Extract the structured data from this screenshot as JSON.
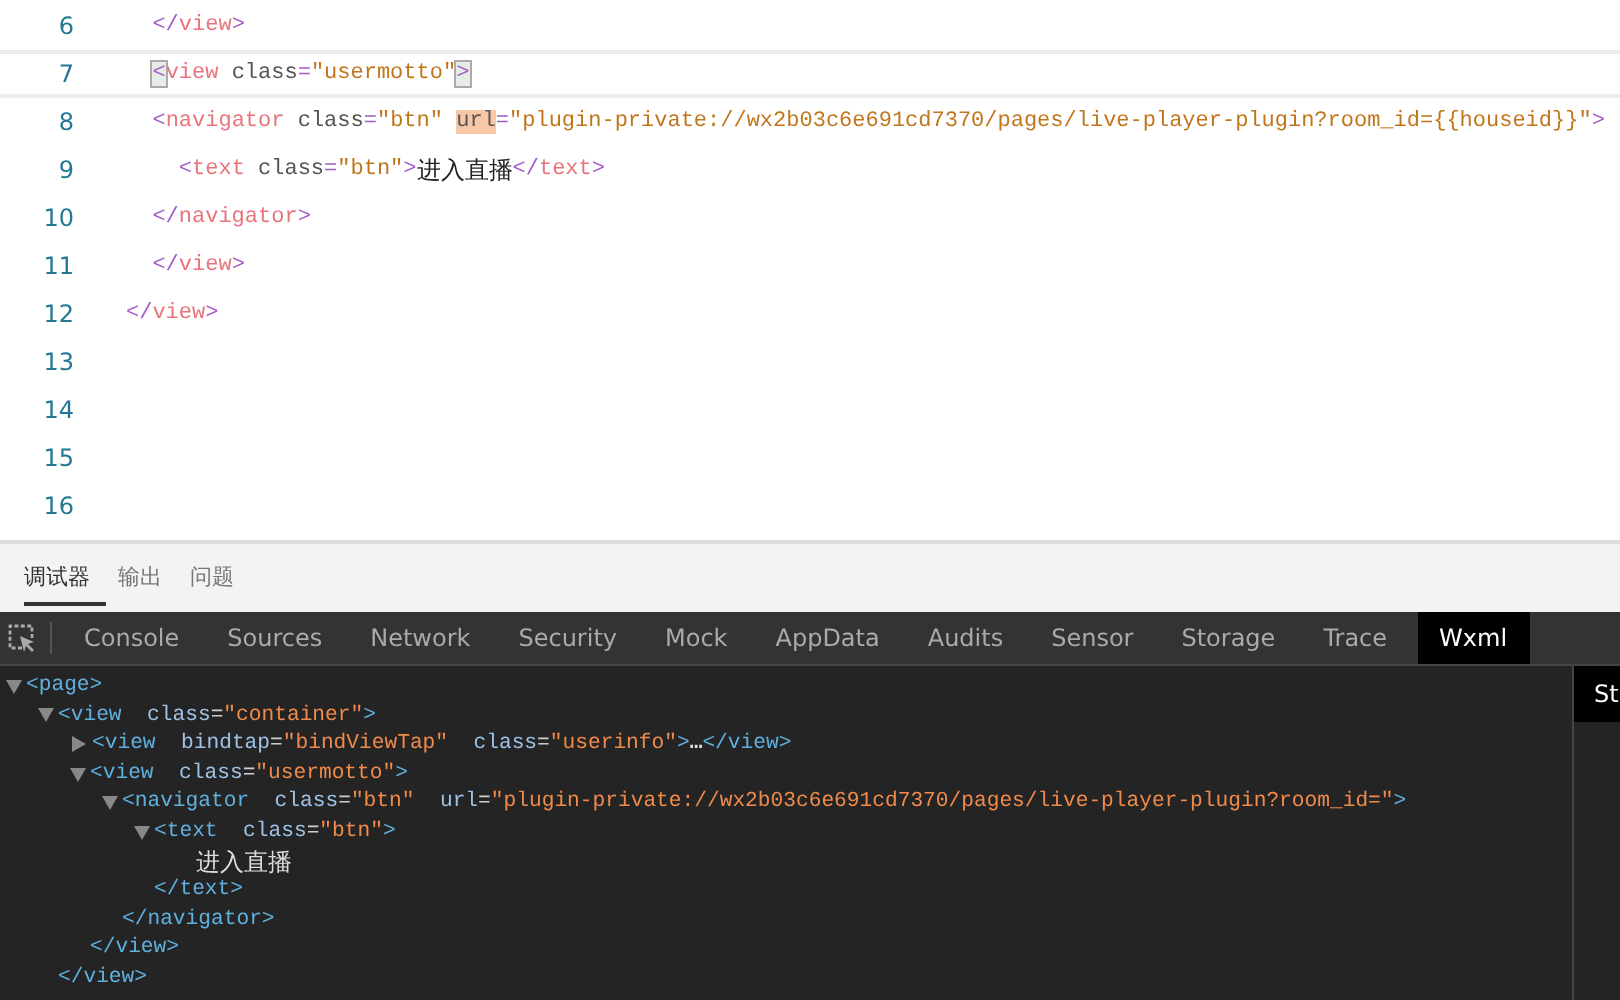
{
  "editor": {
    "lines": [
      {
        "number": "6",
        "current": false,
        "tokens": [
          {
            "kind": "punct",
            "text": "  </"
          },
          {
            "kind": "tag",
            "text": "view"
          },
          {
            "kind": "punct",
            "text": ">"
          }
        ]
      },
      {
        "number": "7",
        "current": true,
        "tokens": [
          {
            "kind": "punct",
            "text": "  <",
            "matched": true
          },
          {
            "kind": "tag",
            "text": "view"
          },
          {
            "kind": "attr",
            "text": " class"
          },
          {
            "kind": "punct",
            "text": "="
          },
          {
            "kind": "string",
            "text": "\"usermotto\""
          },
          {
            "kind": "punct",
            "text": ">",
            "matched": true
          }
        ]
      },
      {
        "number": "8",
        "current": false,
        "tokens": [
          {
            "kind": "punct",
            "text": "  <"
          },
          {
            "kind": "tag",
            "text": "navigator"
          },
          {
            "kind": "attr",
            "text": " class"
          },
          {
            "kind": "punct",
            "text": "="
          },
          {
            "kind": "string",
            "text": "\"btn\""
          },
          {
            "kind": "attr",
            "text": " url",
            "selected": true
          },
          {
            "kind": "punct",
            "text": "="
          },
          {
            "kind": "string",
            "text": "\"plugin-private://wx2b03c6e691cd7370/pages/live-player-plugin?room_id={{houseid}}\""
          },
          {
            "kind": "punct",
            "text": ">"
          }
        ]
      },
      {
        "number": "9",
        "current": false,
        "tokens": [
          {
            "kind": "punct",
            "text": "    <"
          },
          {
            "kind": "tag",
            "text": "text"
          },
          {
            "kind": "attr",
            "text": " class"
          },
          {
            "kind": "punct",
            "text": "="
          },
          {
            "kind": "string",
            "text": "\"btn\""
          },
          {
            "kind": "punct",
            "text": ">"
          },
          {
            "kind": "content",
            "text": "进入直播"
          },
          {
            "kind": "punct",
            "text": "</"
          },
          {
            "kind": "tag",
            "text": "text"
          },
          {
            "kind": "punct",
            "text": ">"
          }
        ]
      },
      {
        "number": "10",
        "current": false,
        "tokens": [
          {
            "kind": "punct",
            "text": "  </"
          },
          {
            "kind": "tag",
            "text": "navigator"
          },
          {
            "kind": "punct",
            "text": ">"
          }
        ]
      },
      {
        "number": "11",
        "current": false,
        "tokens": [
          {
            "kind": "punct",
            "text": "  </"
          },
          {
            "kind": "tag",
            "text": "view"
          },
          {
            "kind": "punct",
            "text": ">"
          }
        ]
      },
      {
        "number": "12",
        "current": false,
        "tokens": [
          {
            "kind": "punct",
            "text": "</"
          },
          {
            "kind": "tag",
            "text": "view"
          },
          {
            "kind": "punct",
            "text": ">"
          }
        ]
      },
      {
        "number": "13",
        "current": false
      },
      {
        "number": "14",
        "current": false
      },
      {
        "number": "15",
        "current": false
      },
      {
        "number": "16",
        "current": false
      }
    ]
  },
  "panel_tabs": [
    {
      "label": "调试器",
      "selected": true
    },
    {
      "label": "输出",
      "selected": false
    },
    {
      "label": "问题",
      "selected": false
    }
  ],
  "devtools_tabs": [
    {
      "label": "Console",
      "selected": false
    },
    {
      "label": "Sources",
      "selected": false
    },
    {
      "label": "Network",
      "selected": false
    },
    {
      "label": "Security",
      "selected": false
    },
    {
      "label": "Mock",
      "selected": false
    },
    {
      "label": "AppData",
      "selected": false
    },
    {
      "label": "Audits",
      "selected": false
    },
    {
      "label": "Sensor",
      "selected": false
    },
    {
      "label": "Storage",
      "selected": false
    },
    {
      "label": "Trace",
      "selected": false
    },
    {
      "label": "Wxml",
      "selected": true
    }
  ],
  "wxml_tree": [
    {
      "kind": "element",
      "expanded": true,
      "open": [
        {
          "kind": "tag",
          "text": "<page>"
        }
      ],
      "children": [
        {
          "kind": "element",
          "expanded": true,
          "open": [
            {
              "kind": "tag",
              "text": "<view"
            },
            {
              "kind": "attr",
              "text": "  class"
            },
            {
              "kind": "punct",
              "text": "="
            },
            {
              "kind": "string",
              "text": "\"container\""
            },
            {
              "kind": "tag",
              "text": ">"
            }
          ],
          "close": "</view>",
          "children": [
            {
              "kind": "element",
              "expanded": false,
              "open": [
                {
                  "kind": "tag",
                  "text": "<view"
                },
                {
                  "kind": "attr",
                  "text": "  bindtap"
                },
                {
                  "kind": "punct",
                  "text": "="
                },
                {
                  "kind": "string",
                  "text": "\"bindViewTap\""
                },
                {
                  "kind": "attr",
                  "text": "  class"
                },
                {
                  "kind": "punct",
                  "text": "="
                },
                {
                  "kind": "string",
                  "text": "\"userinfo\""
                },
                {
                  "kind": "tag",
                  "text": ">"
                }
              ],
              "ellipsis": "…",
              "close": "</view>"
            },
            {
              "kind": "element",
              "expanded": true,
              "open": [
                {
                  "kind": "tag",
                  "text": "<view"
                },
                {
                  "kind": "attr",
                  "text": "  class"
                },
                {
                  "kind": "punct",
                  "text": "="
                },
                {
                  "kind": "string",
                  "text": "\"usermotto\""
                },
                {
                  "kind": "tag",
                  "text": ">"
                }
              ],
              "close": "</view>",
              "children": [
                {
                  "kind": "element",
                  "expanded": true,
                  "open": [
                    {
                      "kind": "tag",
                      "text": "<navigator"
                    },
                    {
                      "kind": "attr",
                      "text": "  class"
                    },
                    {
                      "kind": "punct",
                      "text": "="
                    },
                    {
                      "kind": "string",
                      "text": "\"btn\""
                    },
                    {
                      "kind": "attr",
                      "text": "  url"
                    },
                    {
                      "kind": "punct",
                      "text": "="
                    },
                    {
                      "kind": "string",
                      "text": "\"plugin-private://wx2b03c6e691cd7370/pages/live-player-plugin?room_id=\""
                    },
                    {
                      "kind": "tag",
                      "text": ">"
                    }
                  ],
                  "close": "</navigator>",
                  "children": [
                    {
                      "kind": "element",
                      "expanded": true,
                      "open": [
                        {
                          "kind": "tag",
                          "text": "<text"
                        },
                        {
                          "kind": "attr",
                          "text": "  class"
                        },
                        {
                          "kind": "punct",
                          "text": "="
                        },
                        {
                          "kind": "string",
                          "text": "\"btn\""
                        },
                        {
                          "kind": "tag",
                          "text": ">"
                        }
                      ],
                      "close": "</text>",
                      "children": [
                        {
                          "kind": "text",
                          "text": "进入直播"
                        }
                      ]
                    }
                  ]
                }
              ]
            }
          ]
        }
      ]
    }
  ],
  "side_panel": {
    "tab": "St"
  }
}
